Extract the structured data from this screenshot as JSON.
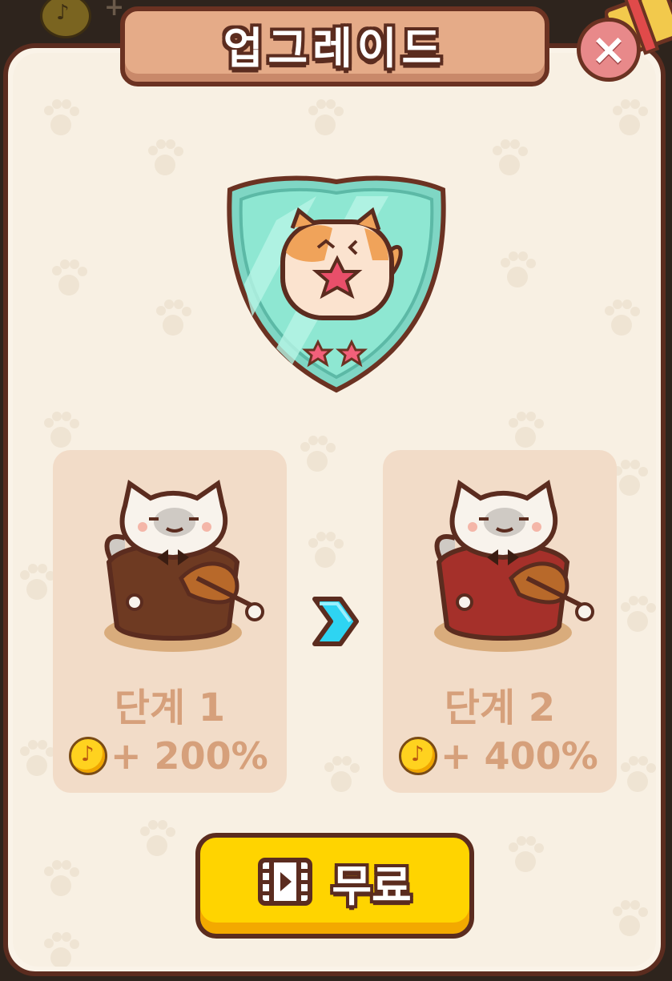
{
  "dialog": {
    "title": "업그레이드",
    "close_icon": "close-icon"
  },
  "background": {
    "coin_symbol": "♪",
    "partial_text": "+"
  },
  "badge": {
    "icon": "cat-character-badge",
    "stars": 2,
    "colors": {
      "shield": "#7fd6c4",
      "border": "#5b2c1f",
      "star": "#f2607a"
    }
  },
  "current_level": {
    "label": "단계 1",
    "coin_symbol": "♪",
    "bonus": "+ 200%",
    "jacket_color": "#6e3a22"
  },
  "next_level": {
    "label": "단계 2",
    "coin_symbol": "♪",
    "bonus": "+ 400%",
    "jacket_color": "#a5302a"
  },
  "upgrade_arrow": "chevron-right-icon",
  "free_button": {
    "label": "무료",
    "icon": "video-film-icon"
  },
  "colors": {
    "panel": "#f8f0e3",
    "border": "#5b2c1f",
    "card": "#f2dcc8",
    "button": "#ffd400",
    "title_plate": "#e5ab88",
    "text_muted": "#d6a07b"
  }
}
